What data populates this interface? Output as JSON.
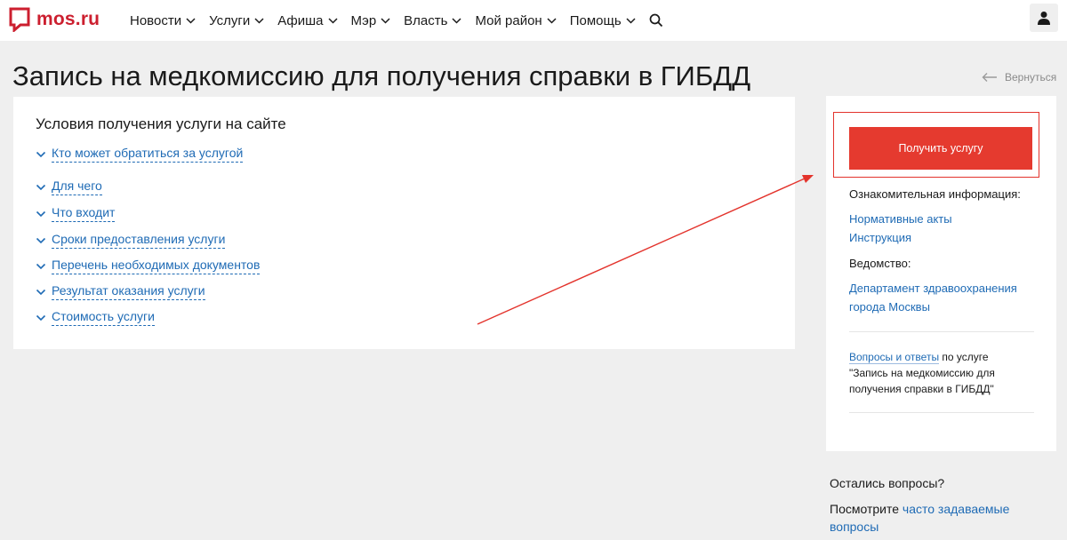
{
  "header": {
    "logo_text": "mos.ru",
    "nav": [
      {
        "label": "Новости"
      },
      {
        "label": "Услуги"
      },
      {
        "label": "Афиша"
      },
      {
        "label": "Мэр"
      },
      {
        "label": "Власть"
      },
      {
        "label": "Мой район"
      },
      {
        "label": "Помощь"
      }
    ],
    "icons": {
      "search": "search-icon",
      "user": "user-icon",
      "logo": "mos-logo-icon"
    }
  },
  "page": {
    "title": "Запись на медкомиссию для получения справки в ГИБДД",
    "back_label": "Вернуться"
  },
  "conditions": {
    "title": "Условия получения услуги на сайте",
    "items": [
      {
        "label": "Кто может обратиться за услугой"
      },
      {
        "label": "Для чего"
      },
      {
        "label": "Что входит"
      },
      {
        "label": "Сроки предоставления услуги"
      },
      {
        "label": "Перечень необходимых документов"
      },
      {
        "label": "Результат оказания услуги"
      },
      {
        "label": "Стоимость услуги"
      }
    ]
  },
  "sidebar": {
    "button_label": "Получить услугу",
    "info_heading": "Ознакомительная информация:",
    "info_links": [
      {
        "label": "Нормативные акты"
      },
      {
        "label": "Инструкция"
      }
    ],
    "agency_heading": "Ведомство:",
    "agency_line1": "Департамент здравоохранения",
    "agency_line2": "города Москвы",
    "faq_link": "Вопросы и ответы",
    "faq_suffix": " по услуге",
    "faq_quote": "\"Запись на медкомиссию для получения справки в ГИБДД\""
  },
  "questions": {
    "title": "Остались вопросы?",
    "prefix": "Посмотрите ",
    "link": "часто задаваемые вопросы"
  },
  "colors": {
    "brand_red": "#cc1f2f",
    "button_red": "#e53a2f",
    "link_blue": "#1f6bb5",
    "background": "#efefef"
  }
}
